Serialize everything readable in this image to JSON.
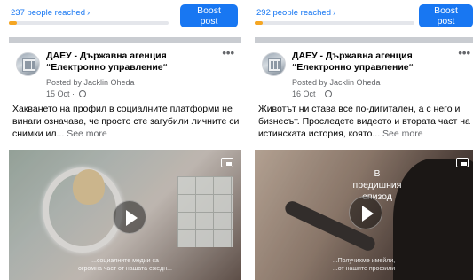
{
  "posts": [
    {
      "reach": {
        "text": "237 people reached",
        "progress_fraction": 0.05
      },
      "boost_label": "Boost post",
      "page_name_line1": "ДАЕУ - Държавна агенция",
      "page_name_line2": "“Електронно управление“",
      "posted_by": "Posted by Jacklin Oheda",
      "date": "15 Oct",
      "text": "Хакването на профил в социалните платформи не винаги означава, че просто сте загубили личните си снимки ил...",
      "see_more": "See more",
      "video_subtitle_line1": "...социалните медии са",
      "video_subtitle_line2": "огромна част от нашата ежедн..."
    },
    {
      "reach": {
        "text": "292 people reached",
        "progress_fraction": 0.05
      },
      "boost_label": "Boost post",
      "page_name_line1": "ДАЕУ - Държавна агенция",
      "page_name_line2": "“Електронно управление“",
      "posted_by": "Posted by Jacklin Oheda",
      "date": "16 Oct",
      "text": "Животът ни става все по-дигитален, а с него и бизнесът. Проследете видеото и втората част на истинската история, която...",
      "see_more": "See more",
      "video_overlay_line1": "В предишния",
      "video_overlay_line2": "епизод",
      "video_subtitle_line1": "...Получихме имейли,",
      "video_subtitle_line2": "...от нашите профили"
    }
  ],
  "icons": {
    "reach_chevron": "chevron-right-icon",
    "more": "more-dots-icon",
    "privacy": "globe-icon",
    "play": "play-icon",
    "pip": "picture-in-picture-icon"
  },
  "colors": {
    "accent": "#1877f2",
    "progress": "#f5a623",
    "secondary_text": "#65676b"
  }
}
